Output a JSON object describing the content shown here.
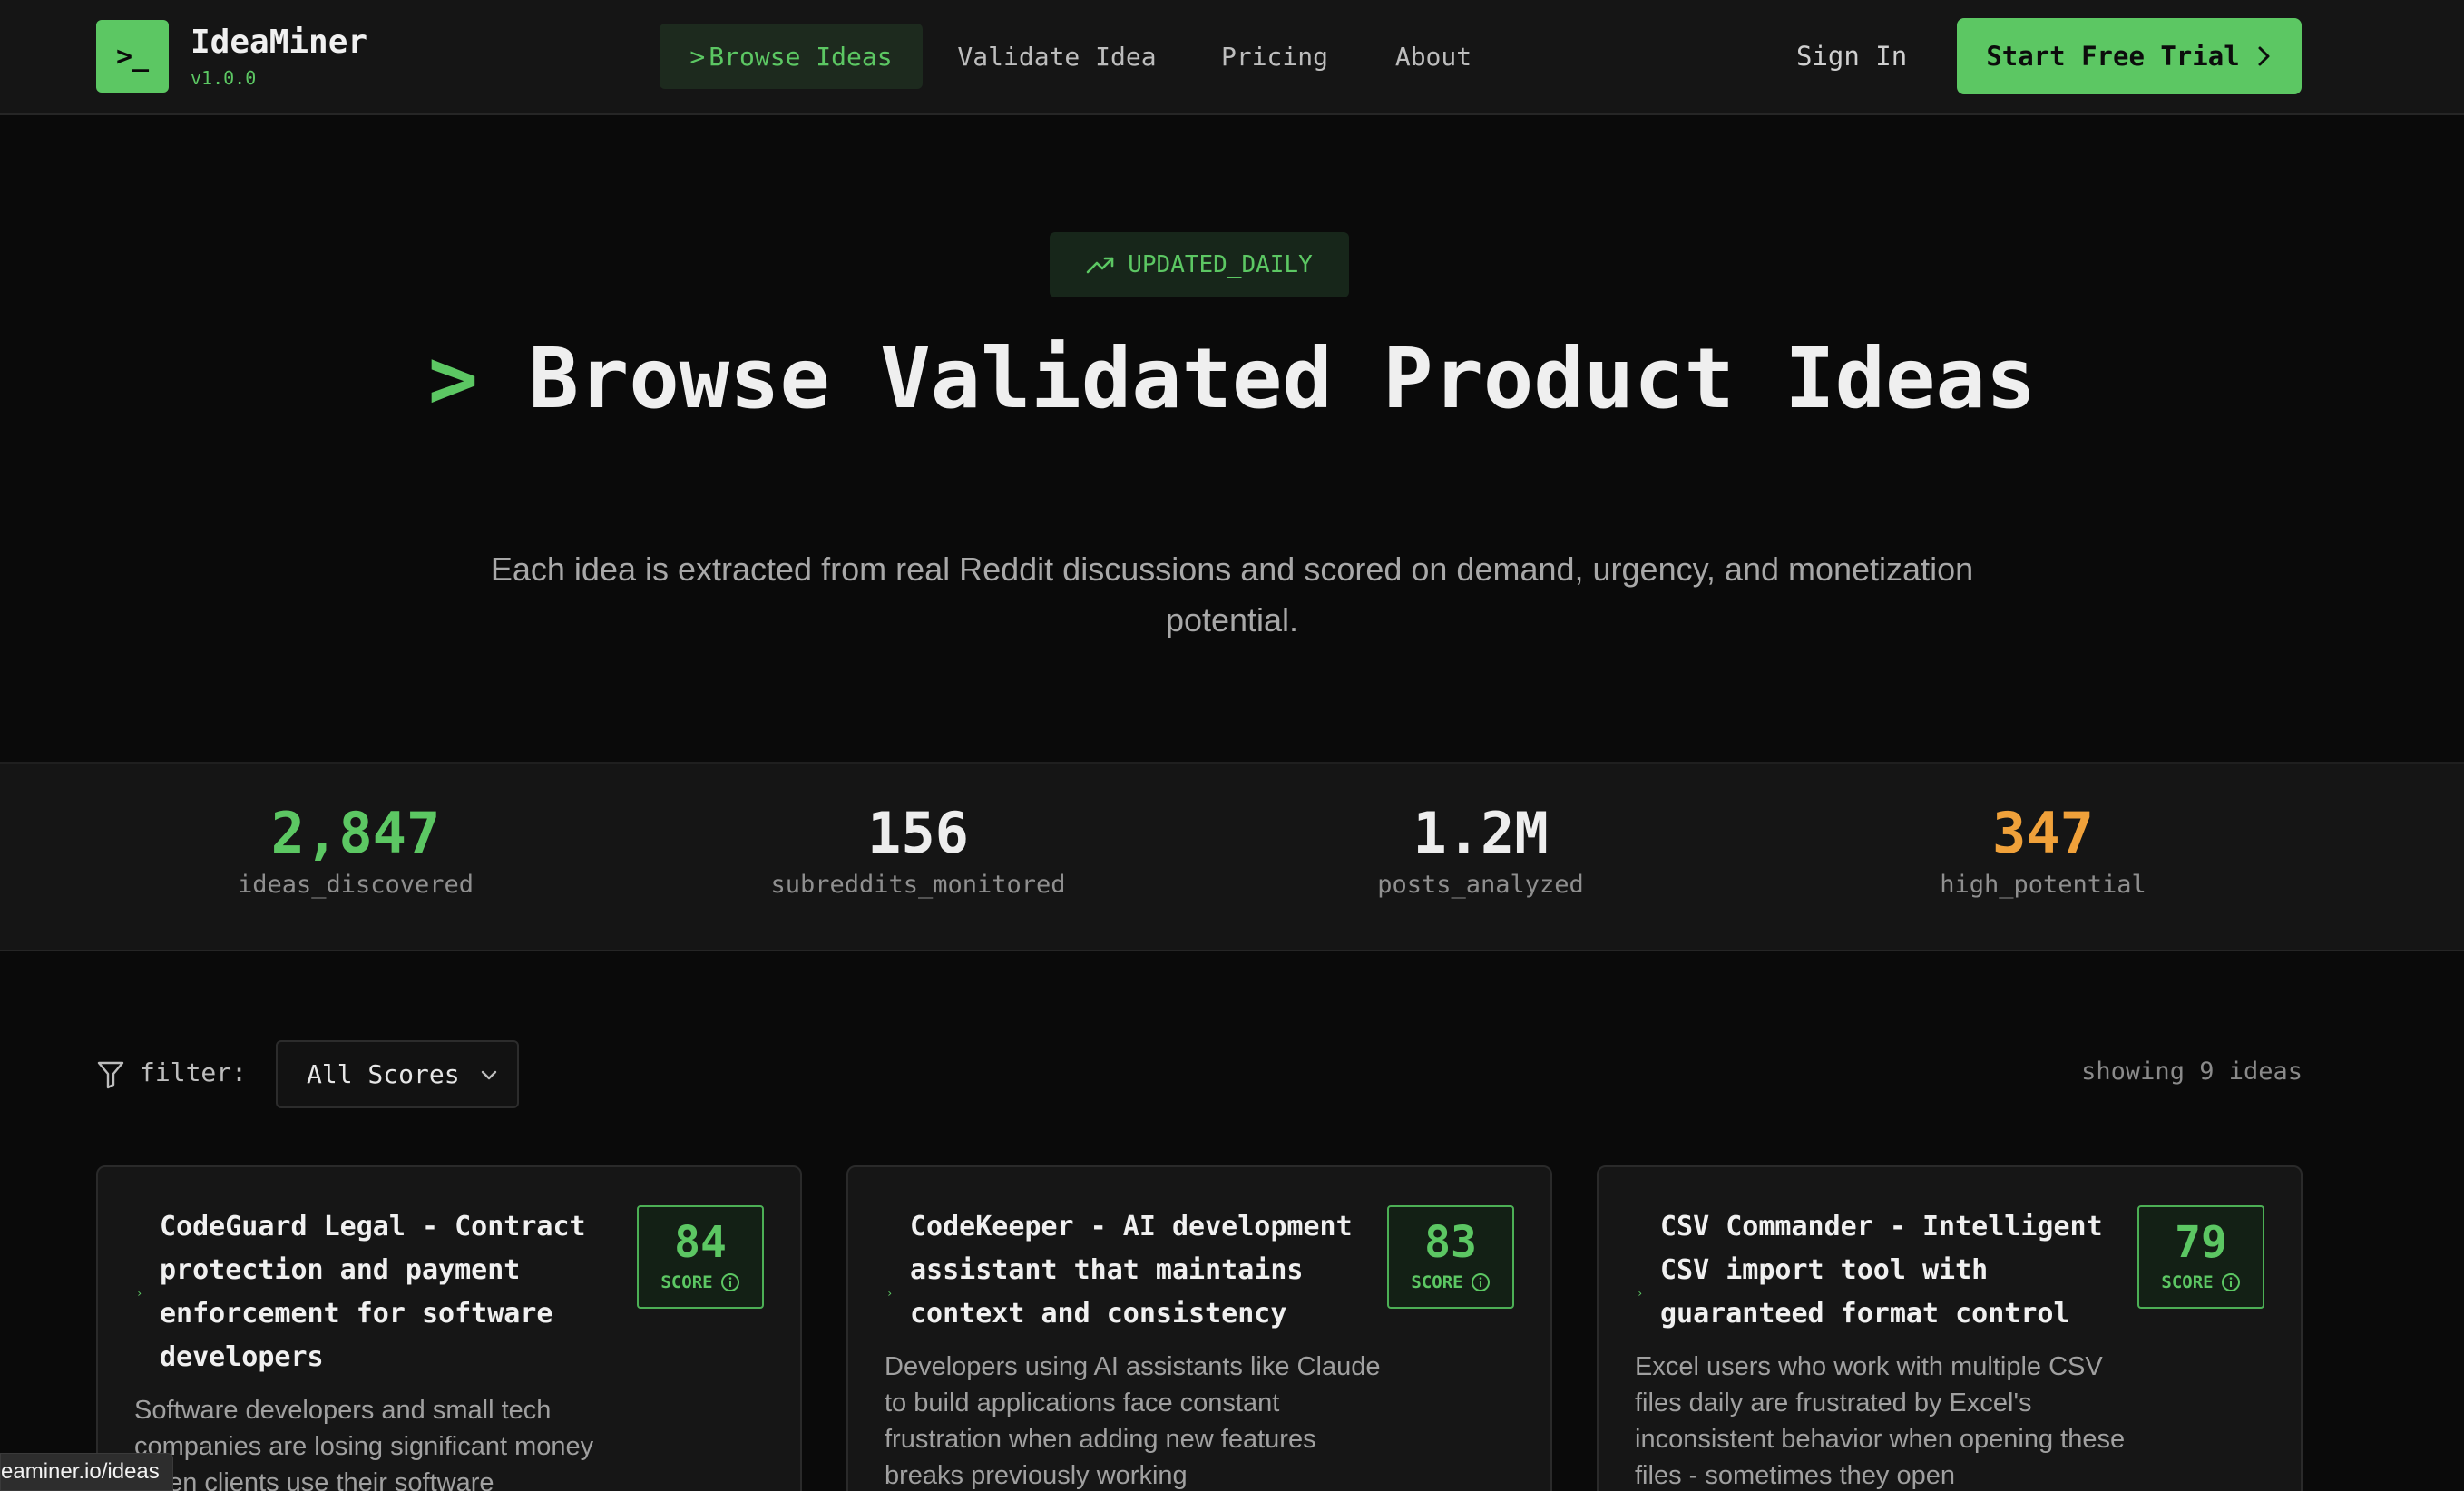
{
  "header": {
    "logo_glyph": ">_",
    "brand_name": "IdeaMiner",
    "version": "v1.0.0",
    "nav": [
      {
        "label": "Browse Ideas",
        "prefix": ">",
        "active": true
      },
      {
        "label": "Validate Idea",
        "active": false
      },
      {
        "label": "Pricing",
        "active": false
      },
      {
        "label": "About",
        "active": false
      }
    ],
    "sign_in": "Sign In",
    "cta": "Start Free Trial"
  },
  "hero": {
    "badge": "UPDATED_DAILY",
    "badge_icon": "trending-up-icon",
    "title_prompt": ">",
    "title": "Browse Validated Product Ideas",
    "subtitle": "Each idea is extracted from real Reddit discussions and scored on demand, urgency, and monetization potential."
  },
  "stats": [
    {
      "value": "2,847",
      "label": "ideas_discovered",
      "color": "#5cc763"
    },
    {
      "value": "156",
      "label": "subreddits_monitored",
      "color": "#ededed"
    },
    {
      "value": "1.2M",
      "label": "posts_analyzed",
      "color": "#ededed"
    },
    {
      "value": "347",
      "label": "high_potential",
      "color": "#f0a13a"
    }
  ],
  "filter": {
    "label": "filter:",
    "selected": "All Scores",
    "showing": "showing 9 ideas"
  },
  "cards": [
    {
      "title": "CodeGuard Legal - Contract protection and payment enforcement for software developers",
      "score": "84",
      "score_label": "SCORE",
      "description": "Software developers and small tech companies are losing significant money when clients use their software"
    },
    {
      "title": "CodeKeeper - AI development assistant that maintains context and consistency",
      "score": "83",
      "score_label": "SCORE",
      "description": "Developers using AI assistants like Claude to build applications face constant frustration when adding new features breaks previously working"
    },
    {
      "title": "CSV Commander - Intelligent CSV import tool with guaranteed format control",
      "score": "79",
      "score_label": "SCORE",
      "description": "Excel users who work with multiple CSV files daily are frustrated by Excel's inconsistent behavior when opening these files - sometimes they open"
    }
  ],
  "status_url": "eaminer.io/ideas",
  "colors": {
    "accent": "#5cc763",
    "background": "#0a0a0a",
    "surface": "#151515",
    "warning": "#f0a13a"
  }
}
